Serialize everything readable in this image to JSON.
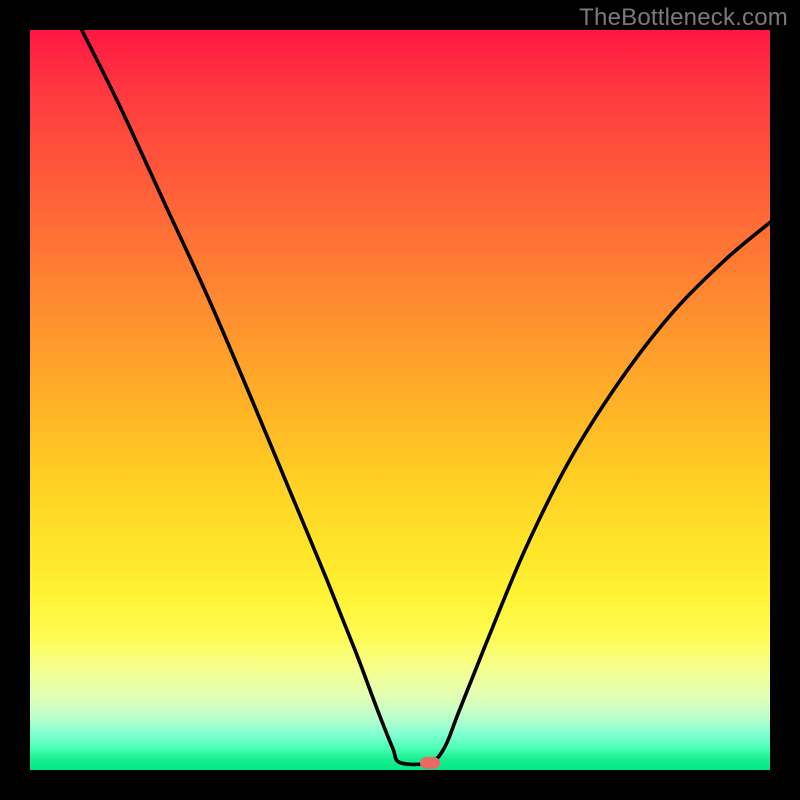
{
  "watermark": "TheBottleneck.com",
  "chart_data": {
    "type": "line",
    "title": "",
    "xlabel": "",
    "ylabel": "",
    "xlim": [
      0,
      100
    ],
    "ylim": [
      0,
      100
    ],
    "grid": false,
    "curve_points": [
      {
        "x": 7,
        "y": 100
      },
      {
        "x": 12,
        "y": 90
      },
      {
        "x": 18,
        "y": 77
      },
      {
        "x": 24,
        "y": 64
      },
      {
        "x": 30,
        "y": 50
      },
      {
        "x": 35,
        "y": 38
      },
      {
        "x": 40,
        "y": 26
      },
      {
        "x": 44,
        "y": 16
      },
      {
        "x": 47,
        "y": 8
      },
      {
        "x": 49,
        "y": 3
      },
      {
        "x": 50,
        "y": 1
      },
      {
        "x": 54,
        "y": 1
      },
      {
        "x": 56,
        "y": 3
      },
      {
        "x": 58,
        "y": 8
      },
      {
        "x": 62,
        "y": 18
      },
      {
        "x": 67,
        "y": 30
      },
      {
        "x": 73,
        "y": 42
      },
      {
        "x": 80,
        "y": 53
      },
      {
        "x": 87,
        "y": 62
      },
      {
        "x": 94,
        "y": 69
      },
      {
        "x": 100,
        "y": 74
      }
    ],
    "marker": {
      "x": 54,
      "y": 1,
      "color": "#e86a63"
    },
    "gradient_colors": {
      "top": "#ff1744",
      "bottom": "#00e885"
    }
  }
}
